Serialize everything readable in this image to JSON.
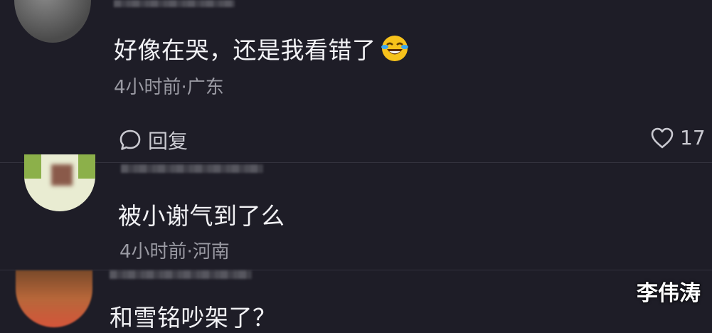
{
  "comments": [
    {
      "text": "好像在哭，还是我看错了",
      "emoji": "laughing-tears-emoji",
      "meta": "4小时前·广东",
      "reply_label": "回复",
      "likes": "17"
    },
    {
      "text": "被小谢气到了么",
      "meta": "4小时前·河南"
    },
    {
      "text": "和雪铭吵架了？"
    }
  ],
  "watermark": "李伟涛",
  "colors": {
    "background": "#1e1d27",
    "text": "#f2f2f5",
    "meta": "#9a9aa3"
  }
}
